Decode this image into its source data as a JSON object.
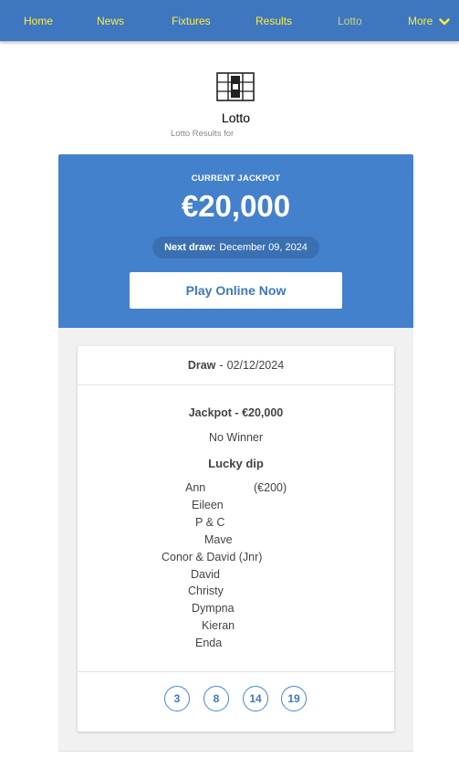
{
  "nav": {
    "items": [
      {
        "label": "Home"
      },
      {
        "label": "News"
      },
      {
        "label": "Fixtures"
      },
      {
        "label": "Results"
      },
      {
        "label": "Lotto"
      },
      {
        "label": "More"
      }
    ],
    "active": "Lotto",
    "more_icon": "chevron-down-icon"
  },
  "header": {
    "icon": "lotto-ticket-icon",
    "title": "Lotto",
    "subtitle": "Lotto Results for"
  },
  "jackpot": {
    "label": "CURRENT JACKPOT",
    "amount": "€20,000",
    "next_draw_label": "Next draw:",
    "next_draw_date": "December 09, 2024",
    "play_button": "Play Online Now"
  },
  "draw": {
    "label": "Draw",
    "separator": "-",
    "date": "02/12/2024",
    "jackpot_line": "Jackpot - €20,000",
    "result": "No Winner",
    "lucky_dip_title": "Lucky dip",
    "winners": [
      "Ann",
      "Eileen",
      "P & C",
      "Mave",
      "Conor & David (Jnr)",
      "David",
      "Christy",
      "Dympna",
      "Kieran",
      "Enda"
    ],
    "prize": "(€200)",
    "numbers": [
      "3",
      "8",
      "14",
      "19"
    ]
  },
  "colors": {
    "nav_bg": "#3e77c0",
    "nav_link": "#ffec3a",
    "jackpot_bg": "#4481cc",
    "ball_border": "#4a86d2"
  }
}
